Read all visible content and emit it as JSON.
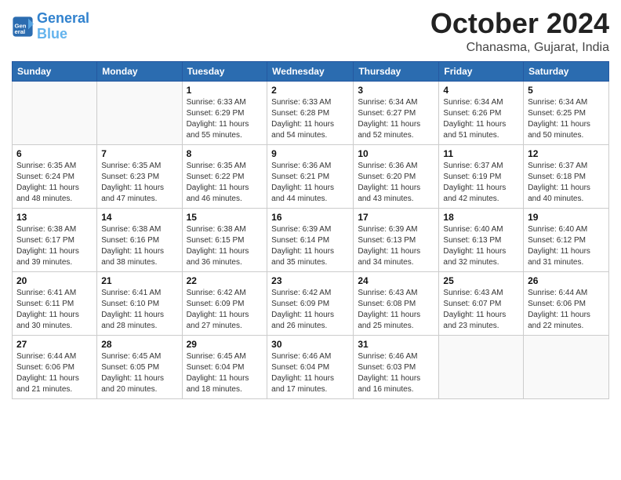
{
  "header": {
    "logo_line1": "General",
    "logo_line2": "Blue",
    "month_title": "October 2024",
    "location": "Chanasma, Gujarat, India"
  },
  "weekdays": [
    "Sunday",
    "Monday",
    "Tuesday",
    "Wednesday",
    "Thursday",
    "Friday",
    "Saturday"
  ],
  "weeks": [
    [
      {
        "day": "",
        "empty": true
      },
      {
        "day": "",
        "empty": true
      },
      {
        "day": "1",
        "sunrise": "6:33 AM",
        "sunset": "6:29 PM",
        "daylight": "11 hours and 55 minutes."
      },
      {
        "day": "2",
        "sunrise": "6:33 AM",
        "sunset": "6:28 PM",
        "daylight": "11 hours and 54 minutes."
      },
      {
        "day": "3",
        "sunrise": "6:34 AM",
        "sunset": "6:27 PM",
        "daylight": "11 hours and 52 minutes."
      },
      {
        "day": "4",
        "sunrise": "6:34 AM",
        "sunset": "6:26 PM",
        "daylight": "11 hours and 51 minutes."
      },
      {
        "day": "5",
        "sunrise": "6:34 AM",
        "sunset": "6:25 PM",
        "daylight": "11 hours and 50 minutes."
      }
    ],
    [
      {
        "day": "6",
        "sunrise": "6:35 AM",
        "sunset": "6:24 PM",
        "daylight": "11 hours and 48 minutes."
      },
      {
        "day": "7",
        "sunrise": "6:35 AM",
        "sunset": "6:23 PM",
        "daylight": "11 hours and 47 minutes."
      },
      {
        "day": "8",
        "sunrise": "6:35 AM",
        "sunset": "6:22 PM",
        "daylight": "11 hours and 46 minutes."
      },
      {
        "day": "9",
        "sunrise": "6:36 AM",
        "sunset": "6:21 PM",
        "daylight": "11 hours and 44 minutes."
      },
      {
        "day": "10",
        "sunrise": "6:36 AM",
        "sunset": "6:20 PM",
        "daylight": "11 hours and 43 minutes."
      },
      {
        "day": "11",
        "sunrise": "6:37 AM",
        "sunset": "6:19 PM",
        "daylight": "11 hours and 42 minutes."
      },
      {
        "day": "12",
        "sunrise": "6:37 AM",
        "sunset": "6:18 PM",
        "daylight": "11 hours and 40 minutes."
      }
    ],
    [
      {
        "day": "13",
        "sunrise": "6:38 AM",
        "sunset": "6:17 PM",
        "daylight": "11 hours and 39 minutes."
      },
      {
        "day": "14",
        "sunrise": "6:38 AM",
        "sunset": "6:16 PM",
        "daylight": "11 hours and 38 minutes."
      },
      {
        "day": "15",
        "sunrise": "6:38 AM",
        "sunset": "6:15 PM",
        "daylight": "11 hours and 36 minutes."
      },
      {
        "day": "16",
        "sunrise": "6:39 AM",
        "sunset": "6:14 PM",
        "daylight": "11 hours and 35 minutes."
      },
      {
        "day": "17",
        "sunrise": "6:39 AM",
        "sunset": "6:13 PM",
        "daylight": "11 hours and 34 minutes."
      },
      {
        "day": "18",
        "sunrise": "6:40 AM",
        "sunset": "6:13 PM",
        "daylight": "11 hours and 32 minutes."
      },
      {
        "day": "19",
        "sunrise": "6:40 AM",
        "sunset": "6:12 PM",
        "daylight": "11 hours and 31 minutes."
      }
    ],
    [
      {
        "day": "20",
        "sunrise": "6:41 AM",
        "sunset": "6:11 PM",
        "daylight": "11 hours and 30 minutes."
      },
      {
        "day": "21",
        "sunrise": "6:41 AM",
        "sunset": "6:10 PM",
        "daylight": "11 hours and 28 minutes."
      },
      {
        "day": "22",
        "sunrise": "6:42 AM",
        "sunset": "6:09 PM",
        "daylight": "11 hours and 27 minutes."
      },
      {
        "day": "23",
        "sunrise": "6:42 AM",
        "sunset": "6:09 PM",
        "daylight": "11 hours and 26 minutes."
      },
      {
        "day": "24",
        "sunrise": "6:43 AM",
        "sunset": "6:08 PM",
        "daylight": "11 hours and 25 minutes."
      },
      {
        "day": "25",
        "sunrise": "6:43 AM",
        "sunset": "6:07 PM",
        "daylight": "11 hours and 23 minutes."
      },
      {
        "day": "26",
        "sunrise": "6:44 AM",
        "sunset": "6:06 PM",
        "daylight": "11 hours and 22 minutes."
      }
    ],
    [
      {
        "day": "27",
        "sunrise": "6:44 AM",
        "sunset": "6:06 PM",
        "daylight": "11 hours and 21 minutes."
      },
      {
        "day": "28",
        "sunrise": "6:45 AM",
        "sunset": "6:05 PM",
        "daylight": "11 hours and 20 minutes."
      },
      {
        "day": "29",
        "sunrise": "6:45 AM",
        "sunset": "6:04 PM",
        "daylight": "11 hours and 18 minutes."
      },
      {
        "day": "30",
        "sunrise": "6:46 AM",
        "sunset": "6:04 PM",
        "daylight": "11 hours and 17 minutes."
      },
      {
        "day": "31",
        "sunrise": "6:46 AM",
        "sunset": "6:03 PM",
        "daylight": "11 hours and 16 minutes."
      },
      {
        "day": "",
        "empty": true
      },
      {
        "day": "",
        "empty": true
      }
    ]
  ]
}
